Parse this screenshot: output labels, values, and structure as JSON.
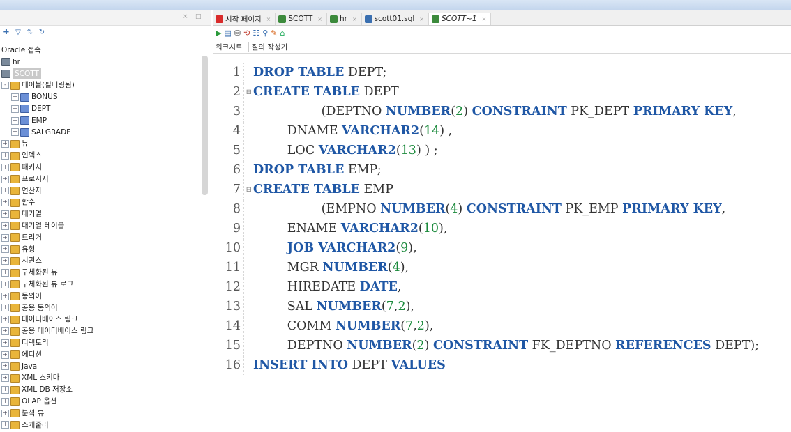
{
  "left_panel": {
    "tree": [
      {
        "indent": 0,
        "expander": "",
        "icon": "none",
        "label": "Oracle 접속"
      },
      {
        "indent": 0,
        "expander": "",
        "icon": "db",
        "label": "hr"
      },
      {
        "indent": 0,
        "expander": "",
        "icon": "db",
        "label": "SCOTT",
        "selected": true
      },
      {
        "indent": 0,
        "expander": "-",
        "icon": "folder",
        "label": "테이블(필터링됨)"
      },
      {
        "indent": 1,
        "expander": "+",
        "icon": "table",
        "label": "BONUS"
      },
      {
        "indent": 1,
        "expander": "+",
        "icon": "table",
        "label": "DEPT"
      },
      {
        "indent": 1,
        "expander": "+",
        "icon": "table",
        "label": "EMP"
      },
      {
        "indent": 1,
        "expander": "+",
        "icon": "table",
        "label": "SALGRADE"
      },
      {
        "indent": 0,
        "expander": "+",
        "icon": "folder",
        "label": "뷰"
      },
      {
        "indent": 0,
        "expander": "+",
        "icon": "folder",
        "label": "인덱스"
      },
      {
        "indent": 0,
        "expander": "+",
        "icon": "folder",
        "label": "패키지"
      },
      {
        "indent": 0,
        "expander": "+",
        "icon": "folder",
        "label": "프로시저"
      },
      {
        "indent": 0,
        "expander": "+",
        "icon": "folder",
        "label": "연산자"
      },
      {
        "indent": 0,
        "expander": "+",
        "icon": "folder",
        "label": "함수"
      },
      {
        "indent": 0,
        "expander": "+",
        "icon": "folder",
        "label": "대기열"
      },
      {
        "indent": 0,
        "expander": "+",
        "icon": "folder",
        "label": "대기열 테이블"
      },
      {
        "indent": 0,
        "expander": "+",
        "icon": "folder",
        "label": "트리거"
      },
      {
        "indent": 0,
        "expander": "+",
        "icon": "folder",
        "label": "유형"
      },
      {
        "indent": 0,
        "expander": "+",
        "icon": "folder",
        "label": "시퀀스"
      },
      {
        "indent": 0,
        "expander": "+",
        "icon": "folder",
        "label": "구체화된 뷰"
      },
      {
        "indent": 0,
        "expander": "+",
        "icon": "folder",
        "label": "구체화된 뷰 로그"
      },
      {
        "indent": 0,
        "expander": "+",
        "icon": "folder",
        "label": "동의어"
      },
      {
        "indent": 0,
        "expander": "+",
        "icon": "folder",
        "label": "공용 동의어"
      },
      {
        "indent": 0,
        "expander": "+",
        "icon": "folder",
        "label": "데이터베이스 링크"
      },
      {
        "indent": 0,
        "expander": "+",
        "icon": "folder",
        "label": "공용 데이터베이스 링크"
      },
      {
        "indent": 0,
        "expander": "+",
        "icon": "folder",
        "label": "디렉토리"
      },
      {
        "indent": 0,
        "expander": "+",
        "icon": "folder",
        "label": "에디션"
      },
      {
        "indent": 0,
        "expander": "+",
        "icon": "folder",
        "label": "Java"
      },
      {
        "indent": 0,
        "expander": "+",
        "icon": "folder",
        "label": "XML 스키마"
      },
      {
        "indent": 0,
        "expander": "+",
        "icon": "folder",
        "label": "XML DB 저장소"
      },
      {
        "indent": 0,
        "expander": "+",
        "icon": "folder",
        "label": "OLAP 옵션"
      },
      {
        "indent": 0,
        "expander": "+",
        "icon": "folder",
        "label": "분석 뷰"
      },
      {
        "indent": 0,
        "expander": "+",
        "icon": "folder",
        "label": "스케줄러"
      }
    ]
  },
  "editor": {
    "tabs": [
      {
        "label": "시작 페이지",
        "icon": "start-page-icon",
        "active": false
      },
      {
        "label": "SCOTT",
        "icon": "connection-icon",
        "active": false
      },
      {
        "label": "hr",
        "icon": "connection-icon",
        "active": false
      },
      {
        "label": "scott01.sql",
        "icon": "sql-file-icon",
        "active": false
      },
      {
        "label": "SCOTT~1",
        "icon": "connection-icon",
        "active": true
      }
    ],
    "subtabs": [
      "워크시트",
      "질의 작성기"
    ],
    "lines": [
      {
        "n": "1",
        "fold": "",
        "indent": 0,
        "tokens": [
          [
            "kw",
            "DROP TABLE"
          ],
          [
            "p",
            " DEPT;"
          ]
        ]
      },
      {
        "n": "2",
        "fold": "⊟",
        "indent": 0,
        "tokens": [
          [
            "kw",
            "CREATE TABLE"
          ],
          [
            "p",
            " DEPT"
          ]
        ]
      },
      {
        "n": "3",
        "fold": "",
        "indent": 8,
        "tokens": [
          [
            "p",
            "(DEPTNO "
          ],
          [
            "kw",
            "NUMBER"
          ],
          [
            "p",
            "("
          ],
          [
            "num",
            "2"
          ],
          [
            "p",
            ") "
          ],
          [
            "kw",
            "CONSTRAINT"
          ],
          [
            "p",
            " PK_DEPT "
          ],
          [
            "kw",
            "PRIMARY KEY"
          ],
          [
            "p",
            ","
          ]
        ]
      },
      {
        "n": "4",
        "fold": "",
        "indent": 4,
        "tokens": [
          [
            "p",
            "DNAME "
          ],
          [
            "kw",
            "VARCHAR2"
          ],
          [
            "p",
            "("
          ],
          [
            "num",
            "14"
          ],
          [
            "p",
            ") ,"
          ]
        ]
      },
      {
        "n": "5",
        "fold": "",
        "indent": 4,
        "tokens": [
          [
            "p",
            "LOC "
          ],
          [
            "kw",
            "VARCHAR2"
          ],
          [
            "p",
            "("
          ],
          [
            "num",
            "13"
          ],
          [
            "p",
            ") ) ;"
          ]
        ]
      },
      {
        "n": "6",
        "fold": "",
        "indent": 0,
        "tokens": [
          [
            "kw",
            "DROP TABLE"
          ],
          [
            "p",
            " EMP;"
          ]
        ]
      },
      {
        "n": "7",
        "fold": "⊟",
        "indent": 0,
        "tokens": [
          [
            "kw",
            "CREATE TABLE"
          ],
          [
            "p",
            " EMP"
          ]
        ]
      },
      {
        "n": "8",
        "fold": "",
        "indent": 8,
        "tokens": [
          [
            "p",
            "(EMPNO "
          ],
          [
            "kw",
            "NUMBER"
          ],
          [
            "p",
            "("
          ],
          [
            "num",
            "4"
          ],
          [
            "p",
            ") "
          ],
          [
            "kw",
            "CONSTRAINT"
          ],
          [
            "p",
            " PK_EMP "
          ],
          [
            "kw",
            "PRIMARY KEY"
          ],
          [
            "p",
            ","
          ]
        ]
      },
      {
        "n": "9",
        "fold": "",
        "indent": 4,
        "tokens": [
          [
            "p",
            "ENAME "
          ],
          [
            "kw",
            "VARCHAR2"
          ],
          [
            "p",
            "("
          ],
          [
            "num",
            "10"
          ],
          [
            "p",
            "),"
          ]
        ]
      },
      {
        "n": "10",
        "fold": "",
        "indent": 4,
        "tokens": [
          [
            "kw",
            "JOB VARCHAR2"
          ],
          [
            "p",
            "("
          ],
          [
            "num",
            "9"
          ],
          [
            "p",
            "),"
          ]
        ]
      },
      {
        "n": "11",
        "fold": "",
        "indent": 4,
        "tokens": [
          [
            "p",
            "MGR "
          ],
          [
            "kw",
            "NUMBER"
          ],
          [
            "p",
            "("
          ],
          [
            "num",
            "4"
          ],
          [
            "p",
            "),"
          ]
        ]
      },
      {
        "n": "12",
        "fold": "",
        "indent": 4,
        "tokens": [
          [
            "p",
            "HIREDATE "
          ],
          [
            "kw",
            "DATE"
          ],
          [
            "p",
            ","
          ]
        ]
      },
      {
        "n": "13",
        "fold": "",
        "indent": 4,
        "tokens": [
          [
            "p",
            "SAL "
          ],
          [
            "kw",
            "NUMBER"
          ],
          [
            "p",
            "("
          ],
          [
            "num",
            "7"
          ],
          [
            "p",
            ","
          ],
          [
            "num",
            "2"
          ],
          [
            "p",
            "),"
          ]
        ]
      },
      {
        "n": "14",
        "fold": "",
        "indent": 4,
        "tokens": [
          [
            "p",
            "COMM "
          ],
          [
            "kw",
            "NUMBER"
          ],
          [
            "p",
            "("
          ],
          [
            "num",
            "7"
          ],
          [
            "p",
            ","
          ],
          [
            "num",
            "2"
          ],
          [
            "p",
            "),"
          ]
        ]
      },
      {
        "n": "15",
        "fold": "",
        "indent": 4,
        "tokens": [
          [
            "p",
            "DEPTNO "
          ],
          [
            "kw",
            "NUMBER"
          ],
          [
            "p",
            "("
          ],
          [
            "num",
            "2"
          ],
          [
            "p",
            ") "
          ],
          [
            "kw",
            "CONSTRAINT"
          ],
          [
            "p",
            " FK_DEPTNO "
          ],
          [
            "kw",
            "REFERENCES"
          ],
          [
            "p",
            " DEPT);"
          ]
        ]
      },
      {
        "n": "16",
        "fold": "",
        "indent": 0,
        "tokens": [
          [
            "kw",
            "INSERT INTO"
          ],
          [
            "p",
            " DEPT "
          ],
          [
            "kw",
            "VALUES"
          ]
        ]
      }
    ]
  }
}
